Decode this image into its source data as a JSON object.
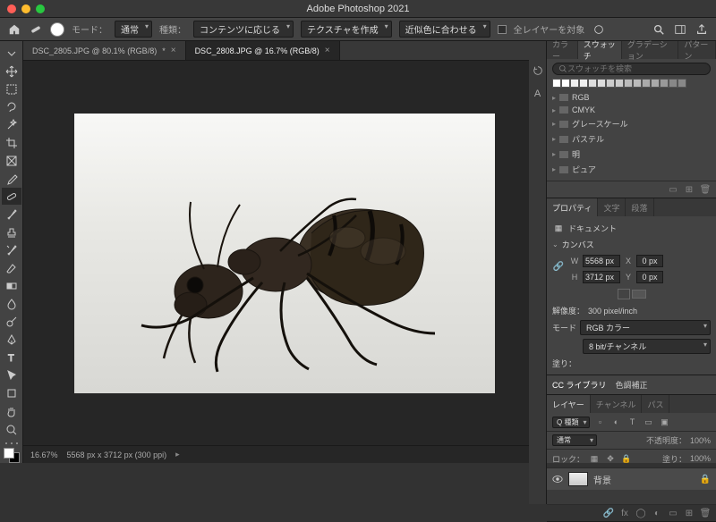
{
  "app_title": "Adobe Photoshop 2021",
  "options_bar": {
    "mode_label": "モード：",
    "mode_value": "通常",
    "type_label": "種類：",
    "btn_content": "コンテンツに応じる",
    "btn_texture": "テクスチャを作成",
    "btn_color": "近似色に合わせる",
    "all_layers_label": "全レイヤーを対象"
  },
  "tabs": [
    {
      "label": "DSC_2805.JPG @ 80.1% (RGB/8)",
      "modified": "*"
    },
    {
      "label": "DSC_2808.JPG @ 16.7% (RGB/8)"
    }
  ],
  "status": {
    "zoom": "16.67%",
    "dims": "5568 px x 3712 px (300 ppi)"
  },
  "swatches": {
    "tabs": [
      "カラー",
      "スウォッチ",
      "グラデーション",
      "パターン"
    ],
    "search_placeholder": "スウォッチを検索",
    "groups": [
      "RGB",
      "CMYK",
      "グレースケール",
      "パステル",
      "明",
      "ピュア"
    ]
  },
  "properties": {
    "tabs": [
      "プロパティ",
      "文字",
      "段落"
    ],
    "doc_label": "ドキュメント",
    "canvas_label": "カンバス",
    "w_label": "W",
    "w_value": "5568 px",
    "x_label": "X",
    "x_value": "0 px",
    "h_label": "H",
    "h_value": "3712 px",
    "y_label": "Y",
    "y_value": "0 px",
    "res_label": "解像度：",
    "res_value": "300 pixel/inch",
    "mode_label": "モード",
    "mode_value": "RGB カラー",
    "depth_value": "8 bit/チャンネル",
    "fill_label": "塗り："
  },
  "cclib": {
    "tab1": "CC ライブラリ",
    "tab2": "色調補正"
  },
  "layers": {
    "tabs": [
      "レイヤー",
      "チャンネル",
      "パス"
    ],
    "kind_value": "Q 種類",
    "blend_value": "通常",
    "opacity_label": "不透明度：",
    "opacity_value": "100%",
    "lock_label": "ロック：",
    "fill_label": "塗り：",
    "fill_value": "100%",
    "layer_name": "背景"
  }
}
